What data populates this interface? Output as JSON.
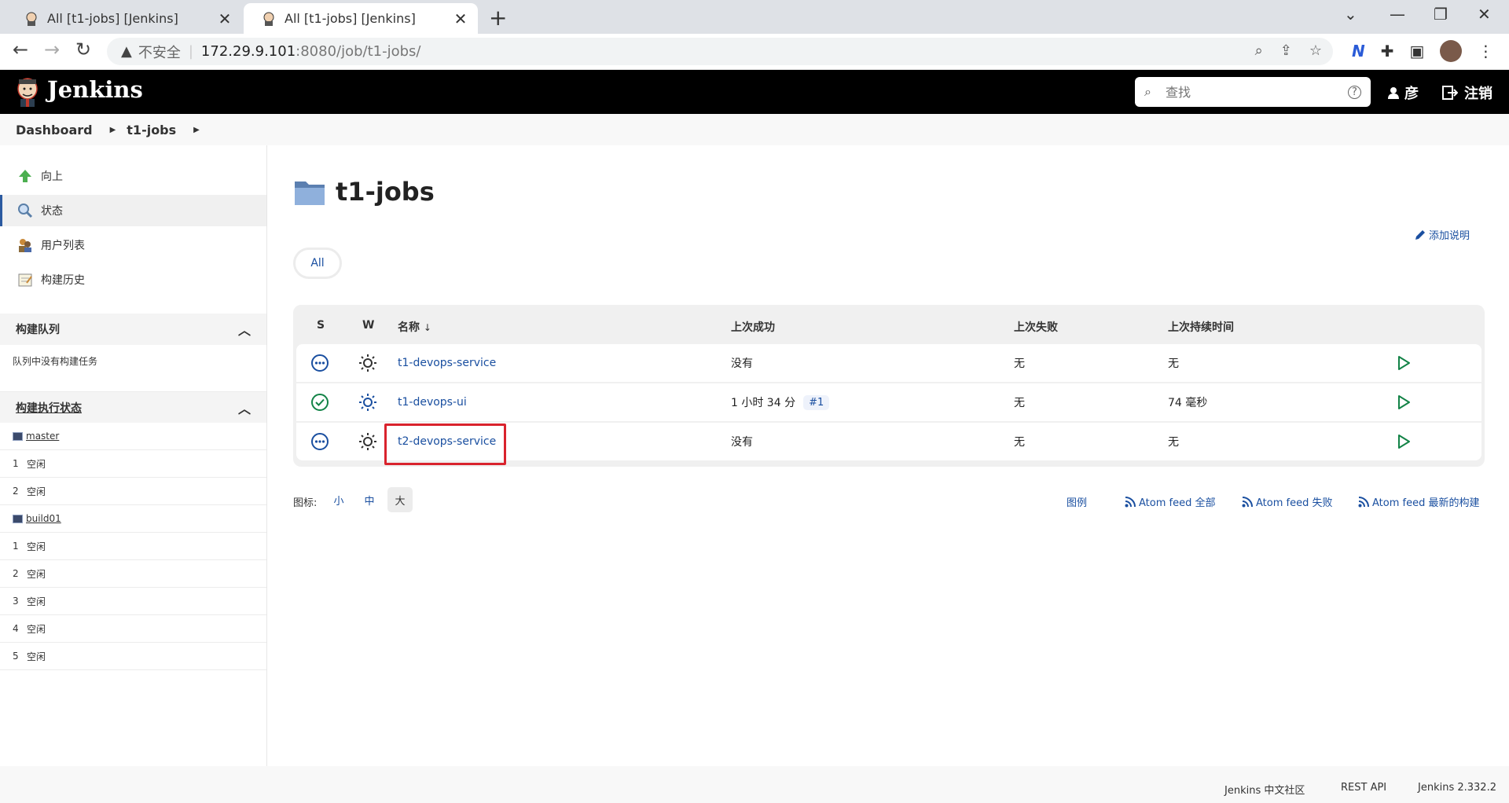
{
  "browser": {
    "tabs": [
      {
        "title": "All [t1-jobs] [Jenkins]",
        "active": false
      },
      {
        "title": "All [t1-jobs] [Jenkins]",
        "active": true
      }
    ],
    "url": {
      "insecure_label": "不安全",
      "host": "172.29.9.101",
      "path": ":8080/job/t1-jobs/"
    }
  },
  "header": {
    "brand": "Jenkins",
    "search_placeholder": "查找",
    "user": "彦",
    "logout": "注销"
  },
  "breadcrumb": [
    "Dashboard",
    "t1-jobs"
  ],
  "sidebar": {
    "tasks": [
      {
        "label": "向上",
        "icon": "up-arrow-icon"
      },
      {
        "label": "状态",
        "icon": "search-icon"
      },
      {
        "label": "用户列表",
        "icon": "users-icon"
      },
      {
        "label": "构建历史",
        "icon": "notepad-icon"
      }
    ],
    "queue": {
      "title": "构建队列",
      "empty_text": "队列中没有构建任务"
    },
    "executors": {
      "title": "构建执行状态",
      "nodes": [
        {
          "name": "master",
          "executors": [
            {
              "num": "1",
              "state": "空闲"
            },
            {
              "num": "2",
              "state": "空闲"
            }
          ]
        },
        {
          "name": "build01",
          "executors": [
            {
              "num": "1",
              "state": "空闲"
            },
            {
              "num": "2",
              "state": "空闲"
            },
            {
              "num": "3",
              "state": "空闲"
            },
            {
              "num": "4",
              "state": "空闲"
            },
            {
              "num": "5",
              "state": "空闲"
            }
          ]
        }
      ]
    }
  },
  "main": {
    "title": "t1-jobs",
    "add_description": "添加说明",
    "view_tab": "All",
    "table": {
      "headers": {
        "s": "S",
        "w": "W",
        "name": "名称",
        "sort_arrow": "↓",
        "last_success": "上次成功",
        "last_failure": "上次失败",
        "last_duration": "上次持续时间"
      },
      "rows": [
        {
          "status": "not-built",
          "name": "t1-devops-service",
          "last_success": "没有",
          "build": "",
          "last_failure": "无",
          "last_duration": "无"
        },
        {
          "status": "success",
          "name": "t1-devops-ui",
          "last_success": "1 小时 34 分",
          "build": "#1",
          "last_failure": "无",
          "last_duration": "74 毫秒"
        },
        {
          "status": "not-built",
          "name": "t2-devops-service",
          "last_success": "没有",
          "build": "",
          "last_failure": "无",
          "last_duration": "无"
        }
      ]
    },
    "icon_size": {
      "label": "图标:",
      "small": "小",
      "medium": "中",
      "large": "大",
      "selected": "大"
    },
    "feeds": {
      "legend": "图例",
      "all": "Atom feed 全部",
      "failed": "Atom feed 失败",
      "latest": "Atom feed 最新的构建"
    }
  },
  "footer": {
    "community": "Jenkins 中文社区",
    "rest_api": "REST API",
    "version": "Jenkins 2.332.2"
  },
  "colors": {
    "link": "#1a4fa0",
    "success": "#138347",
    "highlight": "#d9232d",
    "header_bg": "#000000"
  }
}
